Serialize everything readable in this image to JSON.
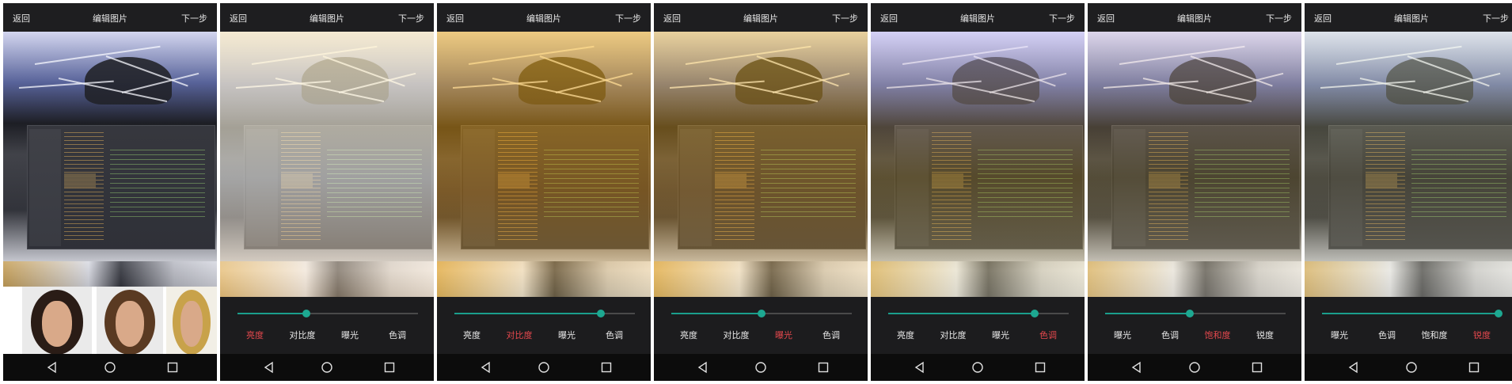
{
  "topbar": {
    "back": "返回",
    "title": "编辑图片",
    "next": "下一步"
  },
  "colors": {
    "accent_slider": "#1a9e8c",
    "active_tab": "#e5484d",
    "tab_text": "#e8e8e8",
    "panel_bg": "#1c1c1e"
  },
  "icons": {
    "nav": [
      "back-triangle-icon",
      "home-circle-icon",
      "recents-square-icon"
    ]
  },
  "panels": [
    {
      "name": "panel-original",
      "tabs": [],
      "faces": true
    },
    {
      "name": "panel-brightness",
      "slider": 0.38,
      "active": 0,
      "tabs": [
        "亮度",
        "对比度",
        "曝光",
        "色调"
      ]
    },
    {
      "name": "panel-contrast",
      "slider": 0.81,
      "active": 1,
      "tabs": [
        "亮度",
        "对比度",
        "曝光",
        "色调"
      ]
    },
    {
      "name": "panel-exposure",
      "slider": 0.5,
      "active": 2,
      "tabs": [
        "亮度",
        "对比度",
        "曝光",
        "色调"
      ]
    },
    {
      "name": "panel-hue",
      "slider": 0.81,
      "active": 3,
      "tabs": [
        "亮度",
        "对比度",
        "曝光",
        "色调"
      ]
    },
    {
      "name": "panel-saturation",
      "slider": 0.47,
      "active": 2,
      "tabs": [
        "曝光",
        "色调",
        "饱和度",
        "锐度"
      ]
    },
    {
      "name": "panel-sharpness",
      "slider": 0.98,
      "active": 3,
      "tabs": [
        "曝光",
        "色调",
        "饱和度",
        "锐度"
      ]
    }
  ]
}
